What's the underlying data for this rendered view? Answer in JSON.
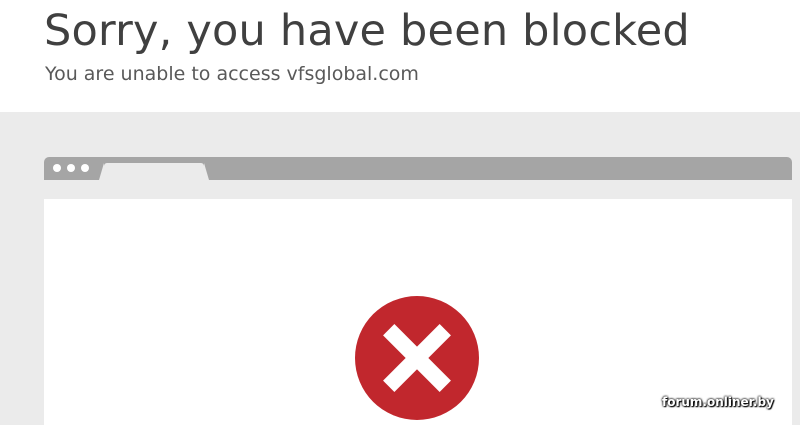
{
  "header": {
    "title": "Sorry, you have been blocked",
    "subtitle": "You are unable to access vfsglobal.com"
  },
  "browser_illustration": {
    "dots_count": 3,
    "error_icon": "x-circle-icon",
    "error_color": "#c1272d"
  },
  "watermark": {
    "text": "forum.onliner.by"
  },
  "colors": {
    "background": "#ffffff",
    "band": "#ebebeb",
    "browser_bar": "#a5a5a5",
    "title_text": "#404040",
    "subtitle_text": "#595959"
  }
}
